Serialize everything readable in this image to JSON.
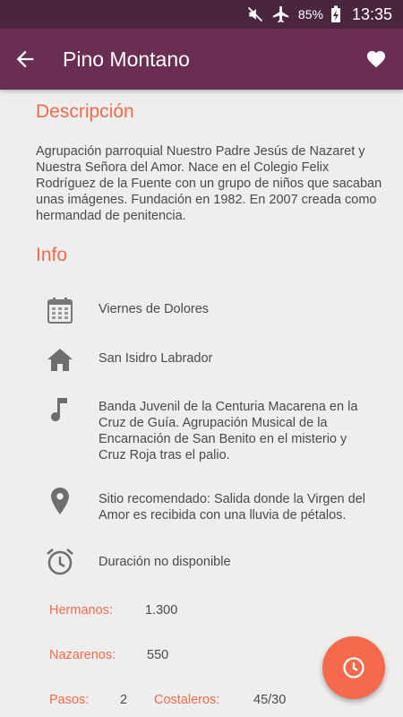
{
  "status_bar": {
    "battery": "85%",
    "time": "13:35",
    "icons": [
      "mute-icon",
      "airplane-mode-icon",
      "battery-charging-icon"
    ]
  },
  "app_bar": {
    "title": "Pino Montano",
    "back_icon": "arrow-back-icon",
    "favorite_icon": "heart-icon"
  },
  "description": {
    "heading": "Descripción",
    "text": "Agrupación parroquial Nuestro Padre Jesús de Nazaret y Nuestra Señora del Amor. Nace en el Colegio Felix Rodríguez de la Fuente con un grupo de niños que sacaban unas imágenes. Fundación en 1982. En 2007 creada como hermandad de penitencia."
  },
  "info": {
    "heading": "Info",
    "items": [
      {
        "icon": "calendar-icon",
        "text": "Viernes de Dolores"
      },
      {
        "icon": "home-icon",
        "text": "San Isidro Labrador"
      },
      {
        "icon": "music-note-icon",
        "text": "Banda Juvenil de la Centuria Macarena en la Cruz de Guía. Agrupación Musical de la Encarnación de San Benito en el misterio y Cruz Roja tras el palio."
      },
      {
        "icon": "location-pin-icon",
        "text": "Sitio recomendado: Salida donde la Virgen del Amor es recibida con una lluvia de pétalos."
      },
      {
        "icon": "alarm-clock-icon",
        "text": "Duración no disponible"
      }
    ]
  },
  "stats": {
    "hermanos": {
      "label": "Hermanos:",
      "value": "1.300"
    },
    "nazarenos": {
      "label": "Nazarenos:",
      "value": "550"
    },
    "pasos": {
      "label": "Pasos:",
      "value": "2"
    },
    "costaleros": {
      "label": "Costaleros:",
      "value": "45/30"
    }
  },
  "fab": {
    "icon": "clock-icon"
  },
  "colors": {
    "status_bar": "#4a2540",
    "app_bar": "#6a2e52",
    "accent": "#f06b4a",
    "background": "#eeeeee",
    "text": "#4a4a4a"
  }
}
